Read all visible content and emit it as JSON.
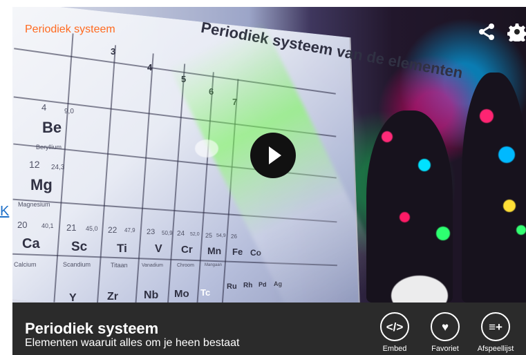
{
  "page": {
    "side_link": "K"
  },
  "player": {
    "top_title": "Periodiek systeem",
    "share_icon": "share-icon",
    "settings_icon": "gear-icon",
    "play_icon": "play-icon",
    "title": "Periodiek systeem",
    "subtitle": "Elementen waaruit alles om je heen bestaat",
    "accent": "#ff6a20",
    "bar_color": "#2b2b2b"
  },
  "video_scene": {
    "poster_title": "Periodiek systeem van de elementen",
    "top_numbers": [
      "3",
      "4",
      "5",
      "6",
      "7"
    ],
    "elements": [
      {
        "symbol": "Be",
        "name": "Beryllium",
        "number": "4",
        "mass": "9,0"
      },
      {
        "symbol": "Mg",
        "name": "Magnesium",
        "number": "12",
        "mass": "24,3"
      },
      {
        "symbol": "Ca",
        "name": "Calcium",
        "number": "20",
        "mass": "40,1"
      },
      {
        "symbol": "Sc",
        "name": "Scandium",
        "number": "21",
        "mass": "45,0"
      },
      {
        "symbol": "Ti",
        "name": "Titaan",
        "number": "22",
        "mass": "47,9"
      },
      {
        "symbol": "V",
        "name": "Vanadium",
        "number": "23",
        "mass": "50,9"
      },
      {
        "symbol": "Cr",
        "name": "Chroom",
        "number": "24",
        "mass": "52,0"
      },
      {
        "symbol": "Mn",
        "name": "Mangaan",
        "number": "25",
        "mass": "54,9"
      },
      {
        "symbol": "Fe",
        "name": "",
        "number": "26",
        "mass": ""
      },
      {
        "symbol": "Co",
        "name": "",
        "number": "",
        "mass": ""
      }
    ],
    "partial_symbols": [
      "Y",
      "Zr",
      "Nb",
      "Mo",
      "Tc",
      "Ru",
      "Rh",
      "Pd",
      "Ag"
    ]
  },
  "actions": [
    {
      "label": "Embed",
      "icon": "embed-icon",
      "symbol": "</>"
    },
    {
      "label": "Favoriet",
      "icon": "heart-icon",
      "symbol": "♥"
    },
    {
      "label": "Afspeellijst",
      "icon": "playlist-add-icon",
      "symbol": "≡+"
    }
  ]
}
